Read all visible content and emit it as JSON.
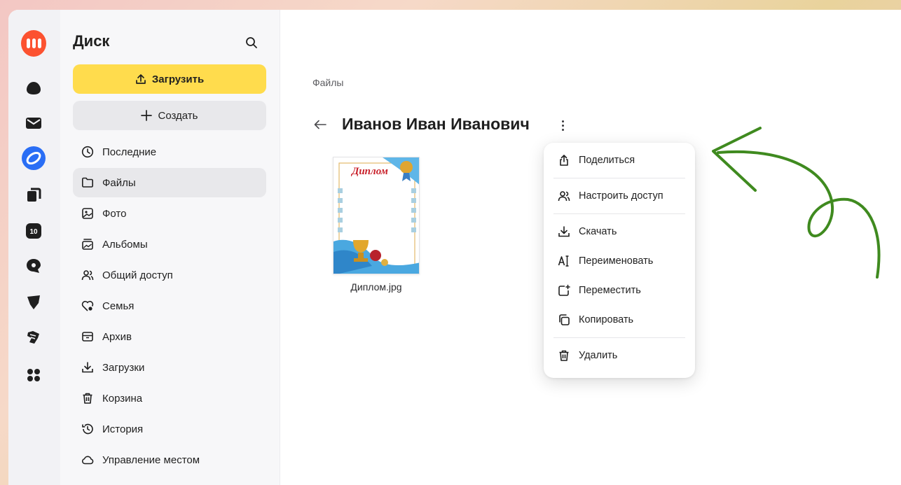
{
  "sidebar": {
    "title": "Диск",
    "upload_label": "Загрузить",
    "create_label": "Создать",
    "items": [
      {
        "label": "Последние",
        "icon": "clock-icon",
        "active": false
      },
      {
        "label": "Файлы",
        "icon": "folder-icon",
        "active": true
      },
      {
        "label": "Фото",
        "icon": "photo-icon",
        "active": false
      },
      {
        "label": "Альбомы",
        "icon": "albums-icon",
        "active": false
      },
      {
        "label": "Общий доступ",
        "icon": "shared-users-icon",
        "active": false
      },
      {
        "label": "Семья",
        "icon": "family-heart-icon",
        "active": false
      },
      {
        "label": "Архив",
        "icon": "archive-icon",
        "active": false
      },
      {
        "label": "Загрузки",
        "icon": "download-icon",
        "active": false
      },
      {
        "label": "Корзина",
        "icon": "trash-icon",
        "active": false
      },
      {
        "label": "История",
        "icon": "history-icon",
        "active": false
      },
      {
        "label": "Управление местом",
        "icon": "cloud-icon",
        "active": false
      }
    ]
  },
  "rail": {
    "badge_10": "10"
  },
  "main": {
    "breadcrumb": "Файлы",
    "folder_title": "Иванов Иван Иванович",
    "file": {
      "name": "Диплом.jpg",
      "thumb_heading": "Диплом"
    }
  },
  "context_menu": {
    "share": "Поделиться",
    "access": "Настроить доступ",
    "download": "Скачать",
    "rename": "Переименовать",
    "move": "Переместить",
    "copy": "Копировать",
    "delete": "Удалить"
  },
  "colors": {
    "accent_yellow": "#ffdc4d",
    "logo_orange": "#fc5230",
    "disk_blue": "#2a6ef5",
    "annotation_green": "#3f8a1f"
  }
}
